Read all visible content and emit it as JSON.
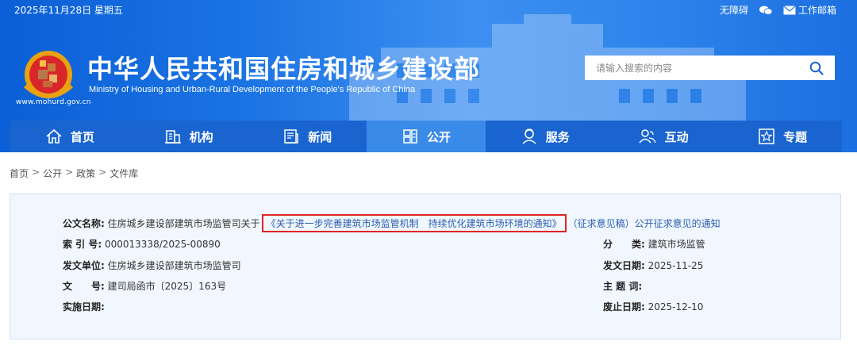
{
  "topbar": {
    "date": "2025年11月28日 星期五",
    "accessibility": "无障碍",
    "wechat_icon": "wechat-icon",
    "mail_icon": "mail-icon",
    "work_mail": "工作邮箱"
  },
  "header": {
    "logo_url": "www.mohurd.gov.cn",
    "title": "中华人民共和国住房和城乡建设部",
    "subtitle": "Ministry of Housing and Urban-Rural Development of the People's Republic of China"
  },
  "search": {
    "placeholder": "请输入搜索的内容",
    "value": ""
  },
  "nav": {
    "items": [
      {
        "label": "首页",
        "icon": "home-icon"
      },
      {
        "label": "机构",
        "icon": "building-icon"
      },
      {
        "label": "新闻",
        "icon": "news-icon"
      },
      {
        "label": "公开",
        "icon": "disclosure-icon",
        "active": true
      },
      {
        "label": "服务",
        "icon": "service-icon"
      },
      {
        "label": "互动",
        "icon": "interact-icon"
      },
      {
        "label": "专题",
        "icon": "topic-icon"
      }
    ]
  },
  "breadcrumb": [
    "首页",
    "公开",
    "政策",
    "文件库"
  ],
  "document": {
    "title_label": "公文名称:",
    "title_prefix": "住房城乡建设部建筑市场监管司关于",
    "title_highlight": "《关于进一步完善建筑市场监管机制　持续优化建筑市场环境的通知》",
    "title_suffix": "（征求意见稿）公开征求意见的通知",
    "index_label": "索 引 号:",
    "index_value": "000013338/2025-00890",
    "category_label": "分　　类:",
    "category_value": "建筑市场监管",
    "issuer_label": "发文单位:",
    "issuer_value": "住房城乡建设部建筑市场监管司",
    "issue_date_label": "发文日期:",
    "issue_date_value": "2025-11-25",
    "docno_label": "文　　号:",
    "docno_value": "建司局函市〔2025〕163号",
    "subject_label": "主 题 词:",
    "subject_value": "",
    "effective_label": "实施日期:",
    "effective_value": "",
    "expiry_label": "废止日期:",
    "expiry_value": "2025-12-10"
  },
  "colors": {
    "header_blue": "#1a73e3",
    "nav_blue": "#1a64d0",
    "nav_active": "#3a8ae8",
    "highlight_border": "#e02424",
    "info_bg": "#f1f7fe"
  }
}
